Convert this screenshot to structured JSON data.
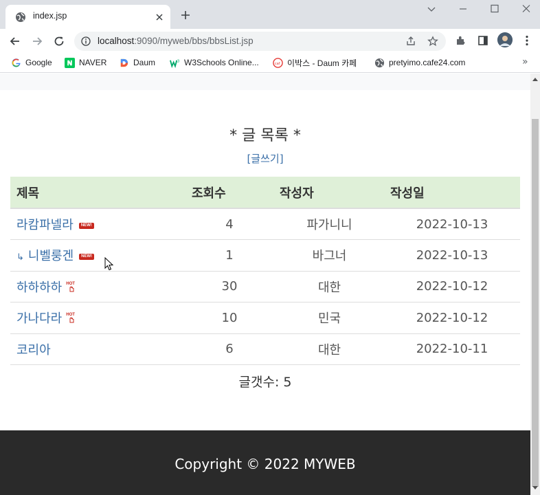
{
  "browser": {
    "tab_title": "index.jsp",
    "url_host": "localhost",
    "url_rest": ":9090/myweb/bbs/bbsList.jsp",
    "bookmarks": [
      {
        "label": "Google",
        "icon": "google-icon"
      },
      {
        "label": "NAVER",
        "icon": "naver-icon"
      },
      {
        "label": "Daum",
        "icon": "daum-icon"
      },
      {
        "label": "W3Schools Online...",
        "icon": "w3schools-icon"
      },
      {
        "label": "이박스 - Daum 카페",
        "icon": "cafe-icon"
      },
      {
        "label": "pretyimo.cafe24.com",
        "icon": "globe-icon"
      }
    ],
    "more_bookmarks": "»"
  },
  "page": {
    "title": "* 글 목록 *",
    "write_link": "[글쓰기]",
    "table": {
      "headers": [
        "제목",
        "조회수",
        "작성자",
        "작성일"
      ],
      "rows": [
        {
          "title": "라캄파넬라",
          "reply": false,
          "badge": "NEW!",
          "views": "4",
          "writer": "파가니니",
          "date": "2022-10-13"
        },
        {
          "title": "니벨룽겐",
          "reply": true,
          "reply_mark": "↳",
          "badge": "NEW!",
          "views": "1",
          "writer": "바그너",
          "date": "2022-10-13"
        },
        {
          "title": "하하하하",
          "reply": false,
          "badge": "HOT",
          "views": "30",
          "writer": "대한",
          "date": "2022-10-12"
        },
        {
          "title": "가나다라",
          "reply": false,
          "badge": "HOT",
          "views": "10",
          "writer": "민국",
          "date": "2022-10-12"
        },
        {
          "title": "코리아",
          "reply": false,
          "badge": "",
          "views": "6",
          "writer": "대한",
          "date": "2022-10-11"
        }
      ]
    },
    "count_text": "글갯수: 5",
    "footer": "Copyright © 2022 MYWEB"
  },
  "colors": {
    "link": "#3a6fa8",
    "header_bg": "#dff0d8",
    "footer_bg": "#2a2a2a",
    "badge_red": "#c8281e"
  }
}
